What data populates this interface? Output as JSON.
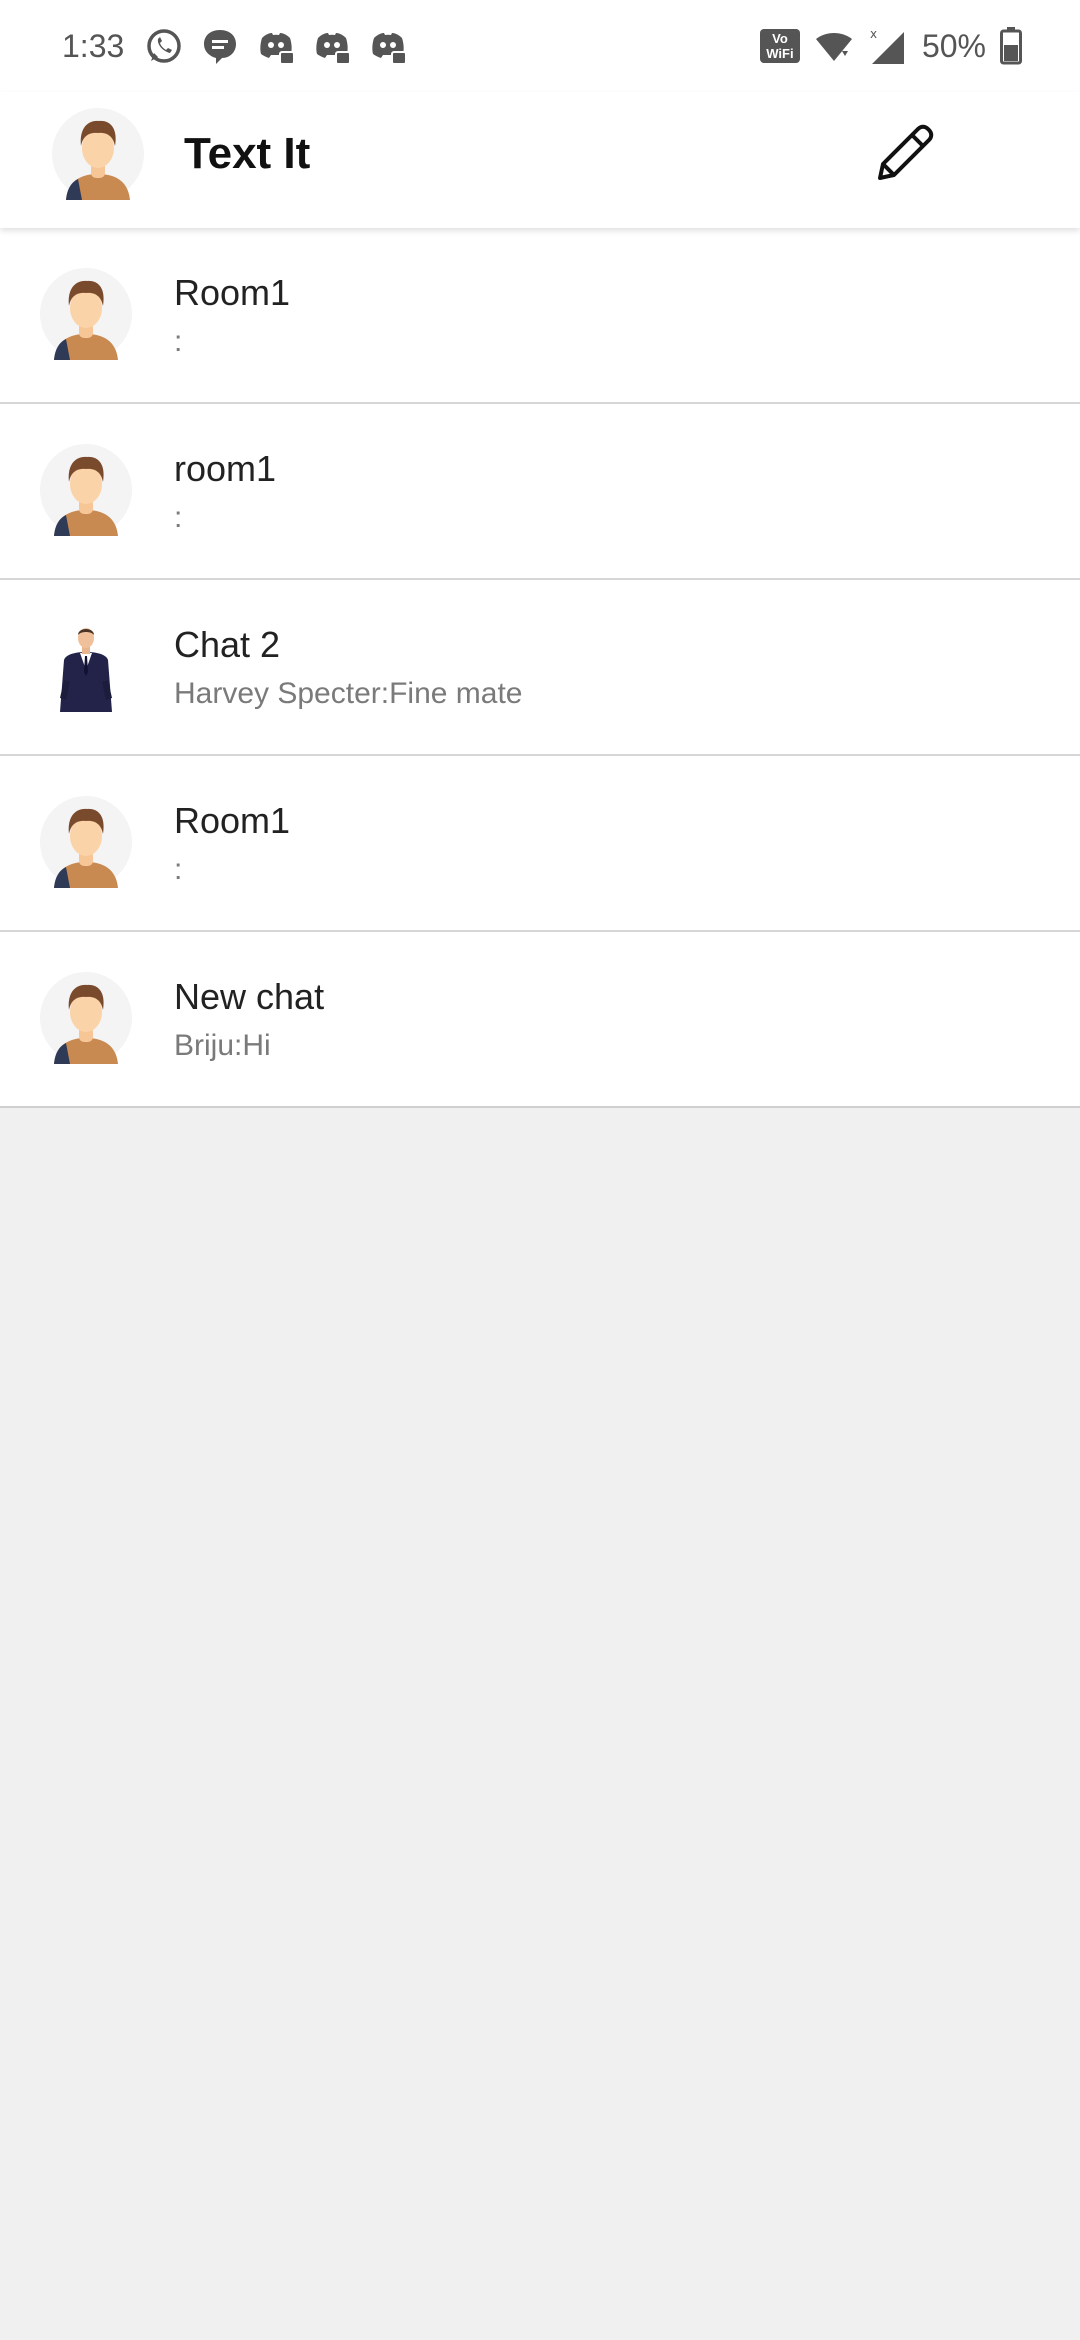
{
  "status_bar": {
    "time": "1:33",
    "left_icons": [
      "whatsapp-icon",
      "message-icon",
      "discord-icon",
      "discord-icon",
      "discord-icon"
    ],
    "vowifi_line1": "Vo",
    "vowifi_line2": "WiFi",
    "battery_percent": "50%"
  },
  "app_bar": {
    "title": "Text It",
    "avatar": "user-avatar",
    "action_icon": "pencil-icon"
  },
  "chats": [
    {
      "name": "Room1",
      "preview": ":",
      "avatar": "default-avatar"
    },
    {
      "name": "room1",
      "preview": ":",
      "avatar": "default-avatar"
    },
    {
      "name": "Chat 2",
      "preview": "Harvey Specter:Fine mate",
      "avatar": "suit-man-avatar"
    },
    {
      "name": "Room1",
      "preview": ":",
      "avatar": "default-avatar"
    },
    {
      "name": "New chat",
      "preview": "Briju:Hi",
      "avatar": "default-avatar"
    }
  ],
  "colors": {
    "background": "#f0f0f0",
    "surface": "#ffffff",
    "divider": "#d6d6d6",
    "preview_text": "#7a7a7a"
  }
}
